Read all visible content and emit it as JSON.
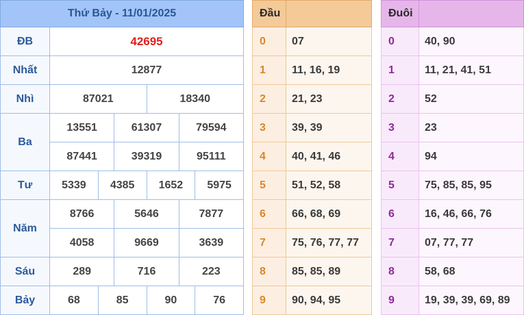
{
  "results": {
    "title": "Thứ Bảy - 11/01/2025",
    "prizes": [
      {
        "label": "ĐB",
        "rows": [
          [
            "42695"
          ]
        ]
      },
      {
        "label": "Nhất",
        "rows": [
          [
            "12877"
          ]
        ]
      },
      {
        "label": "Nhì",
        "rows": [
          [
            "87021",
            "18340"
          ]
        ]
      },
      {
        "label": "Ba",
        "rows": [
          [
            "13551",
            "61307",
            "79594"
          ],
          [
            "87441",
            "39319",
            "95111"
          ]
        ]
      },
      {
        "label": "Tư",
        "rows": [
          [
            "5339",
            "4385",
            "1652",
            "5975"
          ]
        ]
      },
      {
        "label": "Năm",
        "rows": [
          [
            "8766",
            "5646",
            "7877"
          ],
          [
            "4058",
            "9669",
            "3639"
          ]
        ]
      },
      {
        "label": "Sáu",
        "rows": [
          [
            "289",
            "716",
            "223"
          ]
        ]
      },
      {
        "label": "Bảy",
        "rows": [
          [
            "68",
            "85",
            "90",
            "76"
          ]
        ]
      }
    ]
  },
  "dau": {
    "header": "Đầu",
    "rows": [
      {
        "key": "0",
        "values": "07"
      },
      {
        "key": "1",
        "values": "11, 16, 19"
      },
      {
        "key": "2",
        "values": "21, 23"
      },
      {
        "key": "3",
        "values": "39, 39"
      },
      {
        "key": "4",
        "values": "40, 41, 46"
      },
      {
        "key": "5",
        "values": "51, 52, 58"
      },
      {
        "key": "6",
        "values": "66, 68, 69"
      },
      {
        "key": "7",
        "values": "75, 76, 77, 77"
      },
      {
        "key": "8",
        "values": "85, 85, 89"
      },
      {
        "key": "9",
        "values": "90, 94, 95"
      }
    ]
  },
  "duoi": {
    "header": "Đuôi",
    "rows": [
      {
        "key": "0",
        "values": "40, 90"
      },
      {
        "key": "1",
        "values": "11, 21, 41, 51"
      },
      {
        "key": "2",
        "values": "52"
      },
      {
        "key": "3",
        "values": "23"
      },
      {
        "key": "4",
        "values": "94"
      },
      {
        "key": "5",
        "values": "75, 85, 85, 95"
      },
      {
        "key": "6",
        "values": "16, 46, 66, 76"
      },
      {
        "key": "7",
        "values": "07, 77, 77"
      },
      {
        "key": "8",
        "values": "58, 68"
      },
      {
        "key": "9",
        "values": "19, 39, 39, 69, 89"
      }
    ]
  },
  "colors": {
    "special_prize": "#e01f1f",
    "results_header": "#a2c4f9",
    "dau_header": "#f4ca99",
    "duoi_header": "#e6b6ea"
  }
}
